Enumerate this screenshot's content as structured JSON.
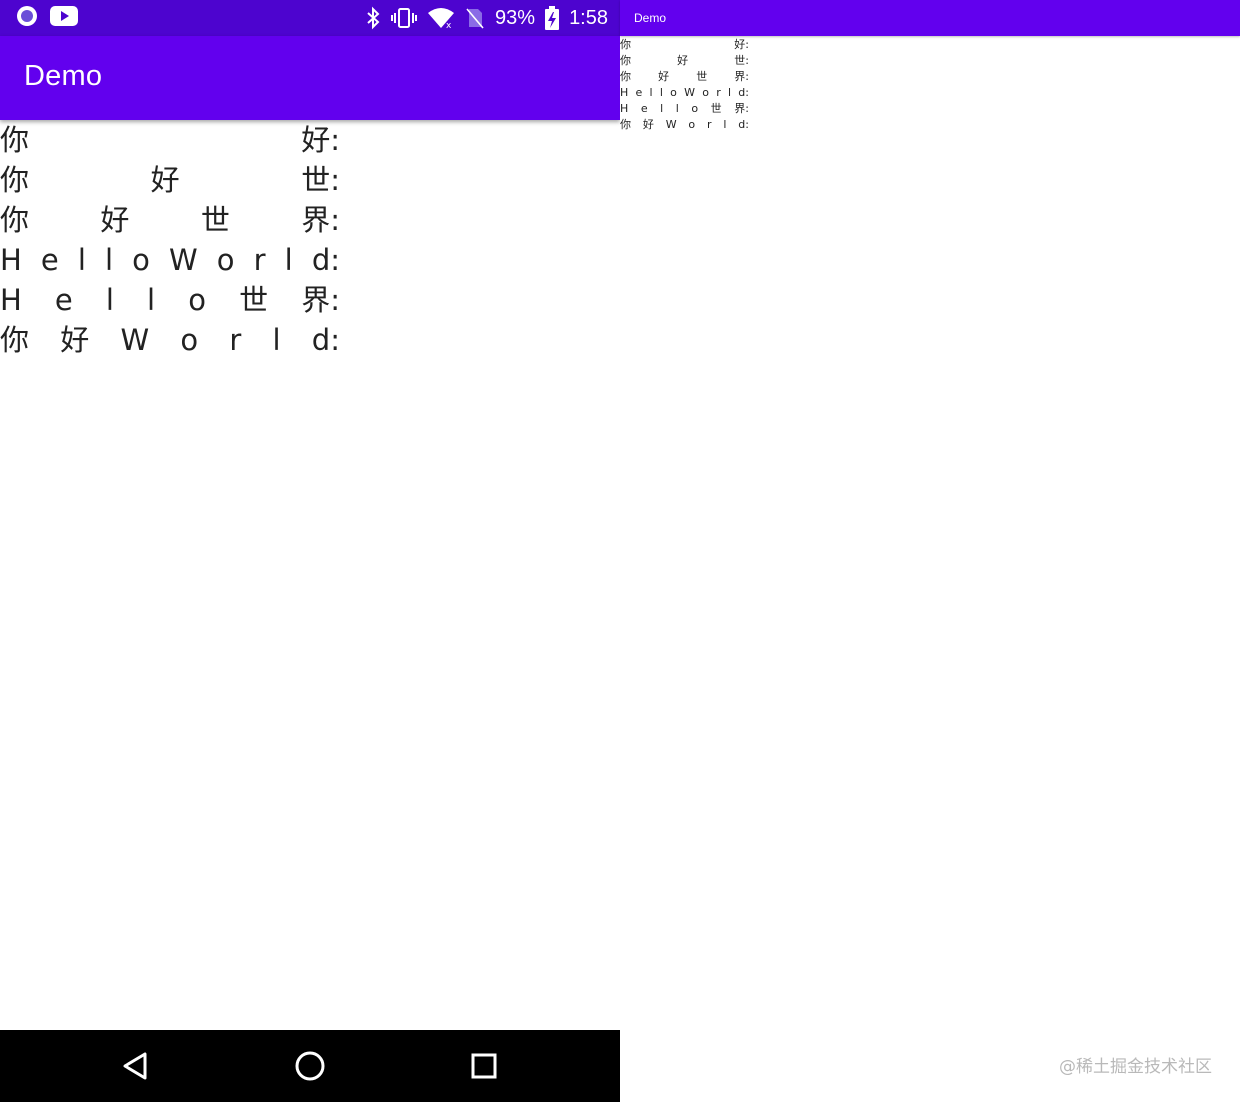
{
  "status_bar": {
    "battery": "93%",
    "time": "1:58",
    "icons_left": [
      "circle-notification-icon",
      "youtube-icon"
    ],
    "icons_right": [
      "bluetooth-icon",
      "vibrate-icon",
      "wifi-icon",
      "no-sim-icon",
      "battery-charging-icon"
    ]
  },
  "app_bar": {
    "title": "Demo"
  },
  "rows": [
    {
      "chars": [
        "你",
        "好:"
      ]
    },
    {
      "chars": [
        "你",
        "好",
        "世:"
      ]
    },
    {
      "chars": [
        "你",
        "好",
        "世",
        "界:"
      ]
    },
    {
      "chars": [
        "H",
        "e",
        "l",
        "l",
        "o",
        "W",
        "o",
        "r",
        "l",
        "d:"
      ]
    },
    {
      "chars": [
        "H",
        "e",
        "l",
        "l",
        "o",
        "世",
        "界:"
      ]
    },
    {
      "chars": [
        "你",
        "好",
        "W",
        "o",
        "r",
        "l",
        "d:"
      ]
    }
  ],
  "nav_bar": {
    "icons": [
      "back-icon",
      "home-icon",
      "recents-icon"
    ]
  },
  "mini": {
    "title": "Demo"
  },
  "watermark": "@稀土掘金技术社区",
  "colors": {
    "status_bar": "#4d04cf",
    "app_bar": "#6200ee",
    "nav_bar": "#000000",
    "text": "#222222"
  }
}
